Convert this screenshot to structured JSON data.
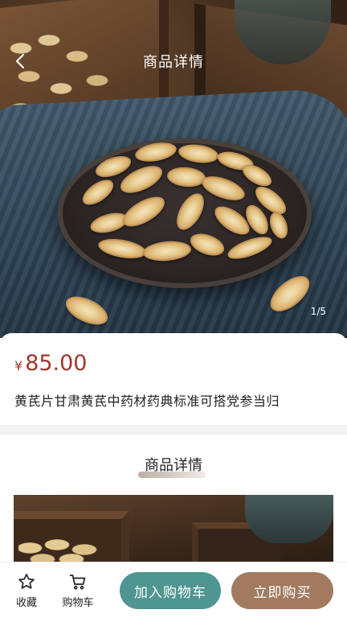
{
  "header": {
    "title": "商品详情",
    "back_icon": "chevron-left-icon"
  },
  "gallery": {
    "counter": "1/5"
  },
  "product": {
    "currency": "¥",
    "price": "85.00",
    "name": "黄芪片甘肃黄芪中药材药典标准可搭党参当归"
  },
  "detail_section": {
    "heading": "商品详情"
  },
  "bottom_bar": {
    "favorite_label": "收藏",
    "favorite_icon": "star-icon",
    "cart_label": "购物车",
    "cart_icon": "shopping-cart-icon",
    "add_to_cart_label": "加入购物车",
    "buy_now_label": "立即购买"
  },
  "colors": {
    "price": "#a0382f",
    "add_to_cart_button": "#4f9591",
    "buy_now_button": "#a17a5f"
  }
}
